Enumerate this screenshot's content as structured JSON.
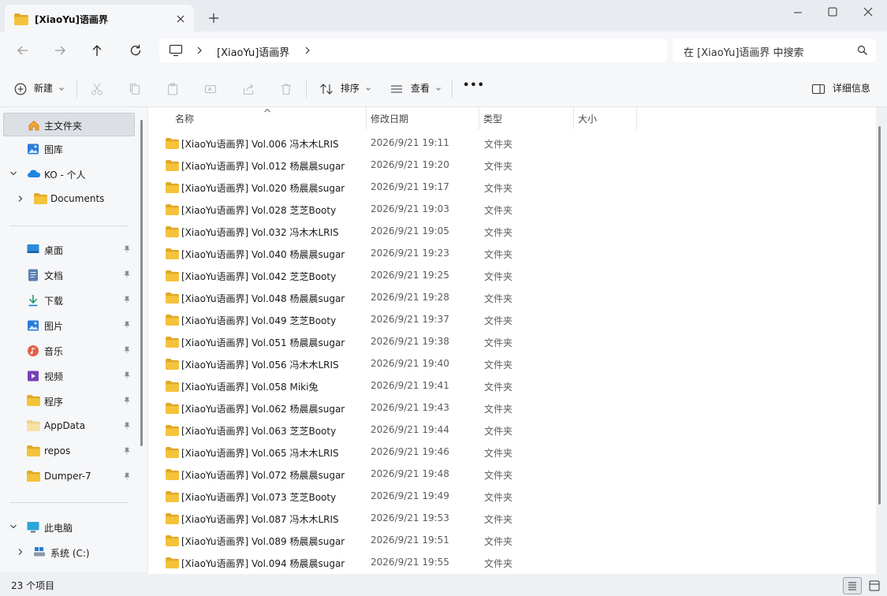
{
  "tab": {
    "title": "[XiaoYu]语画界"
  },
  "address": {
    "crumb": "[XiaoYu]语画界"
  },
  "search": {
    "placeholder": "在 [XiaoYu]语画界 中搜索"
  },
  "toolbar": {
    "new_label": "新建",
    "sort_label": "排序",
    "view_label": "查看",
    "more_label": "•••",
    "details_label": "详细信息"
  },
  "sidebar": {
    "items": [
      {
        "label": "主文件夹",
        "icon": "home-icon",
        "selected": true
      },
      {
        "label": "图库",
        "icon": "gallery-icon"
      },
      {
        "label": "KO - 个人",
        "icon": "cloud-icon"
      },
      {
        "label": "Documents",
        "icon": "folder-icon"
      },
      {
        "label": "桌面",
        "icon": "desktop-icon"
      },
      {
        "label": "文档",
        "icon": "document-icon"
      },
      {
        "label": "下载",
        "icon": "download-icon"
      },
      {
        "label": "图片",
        "icon": "picture-icon"
      },
      {
        "label": "音乐",
        "icon": "music-icon"
      },
      {
        "label": "视频",
        "icon": "video-icon"
      },
      {
        "label": "程序",
        "icon": "folder-icon"
      },
      {
        "label": "AppData",
        "icon": "folder-icon"
      },
      {
        "label": "repos",
        "icon": "folder-icon"
      },
      {
        "label": "Dumper-7",
        "icon": "folder-icon"
      },
      {
        "label": "此电脑",
        "icon": "pc-icon"
      },
      {
        "label": "系统 (C:)",
        "icon": "drive-icon"
      }
    ]
  },
  "columns": {
    "name": "名称",
    "date": "修改日期",
    "type": "类型",
    "size": "大小"
  },
  "files": [
    {
      "name": "[XiaoYu语画界] Vol.006 冯木木LRIS",
      "date": "2026/9/21 19:11",
      "type": "文件夹"
    },
    {
      "name": "[XiaoYu语画界] Vol.012 杨晨晨sugar",
      "date": "2026/9/21 19:20",
      "type": "文件夹"
    },
    {
      "name": "[XiaoYu语画界] Vol.020 杨晨晨sugar",
      "date": "2026/9/21 19:17",
      "type": "文件夹"
    },
    {
      "name": "[XiaoYu语画界] Vol.028 芝芝Booty",
      "date": "2026/9/21 19:03",
      "type": "文件夹"
    },
    {
      "name": "[XiaoYu语画界] Vol.032 冯木木LRIS",
      "date": "2026/9/21 19:05",
      "type": "文件夹"
    },
    {
      "name": "[XiaoYu语画界] Vol.040 杨晨晨sugar",
      "date": "2026/9/21 19:23",
      "type": "文件夹"
    },
    {
      "name": "[XiaoYu语画界] Vol.042 芝芝Booty",
      "date": "2026/9/21 19:25",
      "type": "文件夹"
    },
    {
      "name": "[XiaoYu语画界] Vol.048 杨晨晨sugar",
      "date": "2026/9/21 19:28",
      "type": "文件夹"
    },
    {
      "name": "[XiaoYu语画界] Vol.049 芝芝Booty",
      "date": "2026/9/21 19:37",
      "type": "文件夹"
    },
    {
      "name": "[XiaoYu语画界] Vol.051 杨晨晨sugar",
      "date": "2026/9/21 19:38",
      "type": "文件夹"
    },
    {
      "name": "[XiaoYu语画界] Vol.056 冯木木LRIS",
      "date": "2026/9/21 19:40",
      "type": "文件夹"
    },
    {
      "name": "[XiaoYu语画界] Vol.058 Miki兔",
      "date": "2026/9/21 19:41",
      "type": "文件夹"
    },
    {
      "name": "[XiaoYu语画界] Vol.062 杨晨晨sugar",
      "date": "2026/9/21 19:43",
      "type": "文件夹"
    },
    {
      "name": "[XiaoYu语画界] Vol.063 芝芝Booty",
      "date": "2026/9/21 19:44",
      "type": "文件夹"
    },
    {
      "name": "[XiaoYu语画界] Vol.065 冯木木LRIS",
      "date": "2026/9/21 19:46",
      "type": "文件夹"
    },
    {
      "name": "[XiaoYu语画界] Vol.072 杨晨晨sugar",
      "date": "2026/9/21 19:48",
      "type": "文件夹"
    },
    {
      "name": "[XiaoYu语画界] Vol.073 芝芝Booty",
      "date": "2026/9/21 19:49",
      "type": "文件夹"
    },
    {
      "name": "[XiaoYu语画界] Vol.087 冯木木LRIS",
      "date": "2026/9/21 19:53",
      "type": "文件夹"
    },
    {
      "name": "[XiaoYu语画界] Vol.089 杨晨晨sugar",
      "date": "2026/9/21 19:51",
      "type": "文件夹"
    },
    {
      "name": "[XiaoYu语画界] Vol.094 杨晨晨sugar",
      "date": "2026/9/21 19:55",
      "type": "文件夹"
    }
  ],
  "status": {
    "count": "23 个项目"
  },
  "colors": {
    "folder": "#f5c33b",
    "folder_dark": "#e0a826",
    "accent": "#0067c0",
    "selected_bg": "#dcdfe4"
  }
}
